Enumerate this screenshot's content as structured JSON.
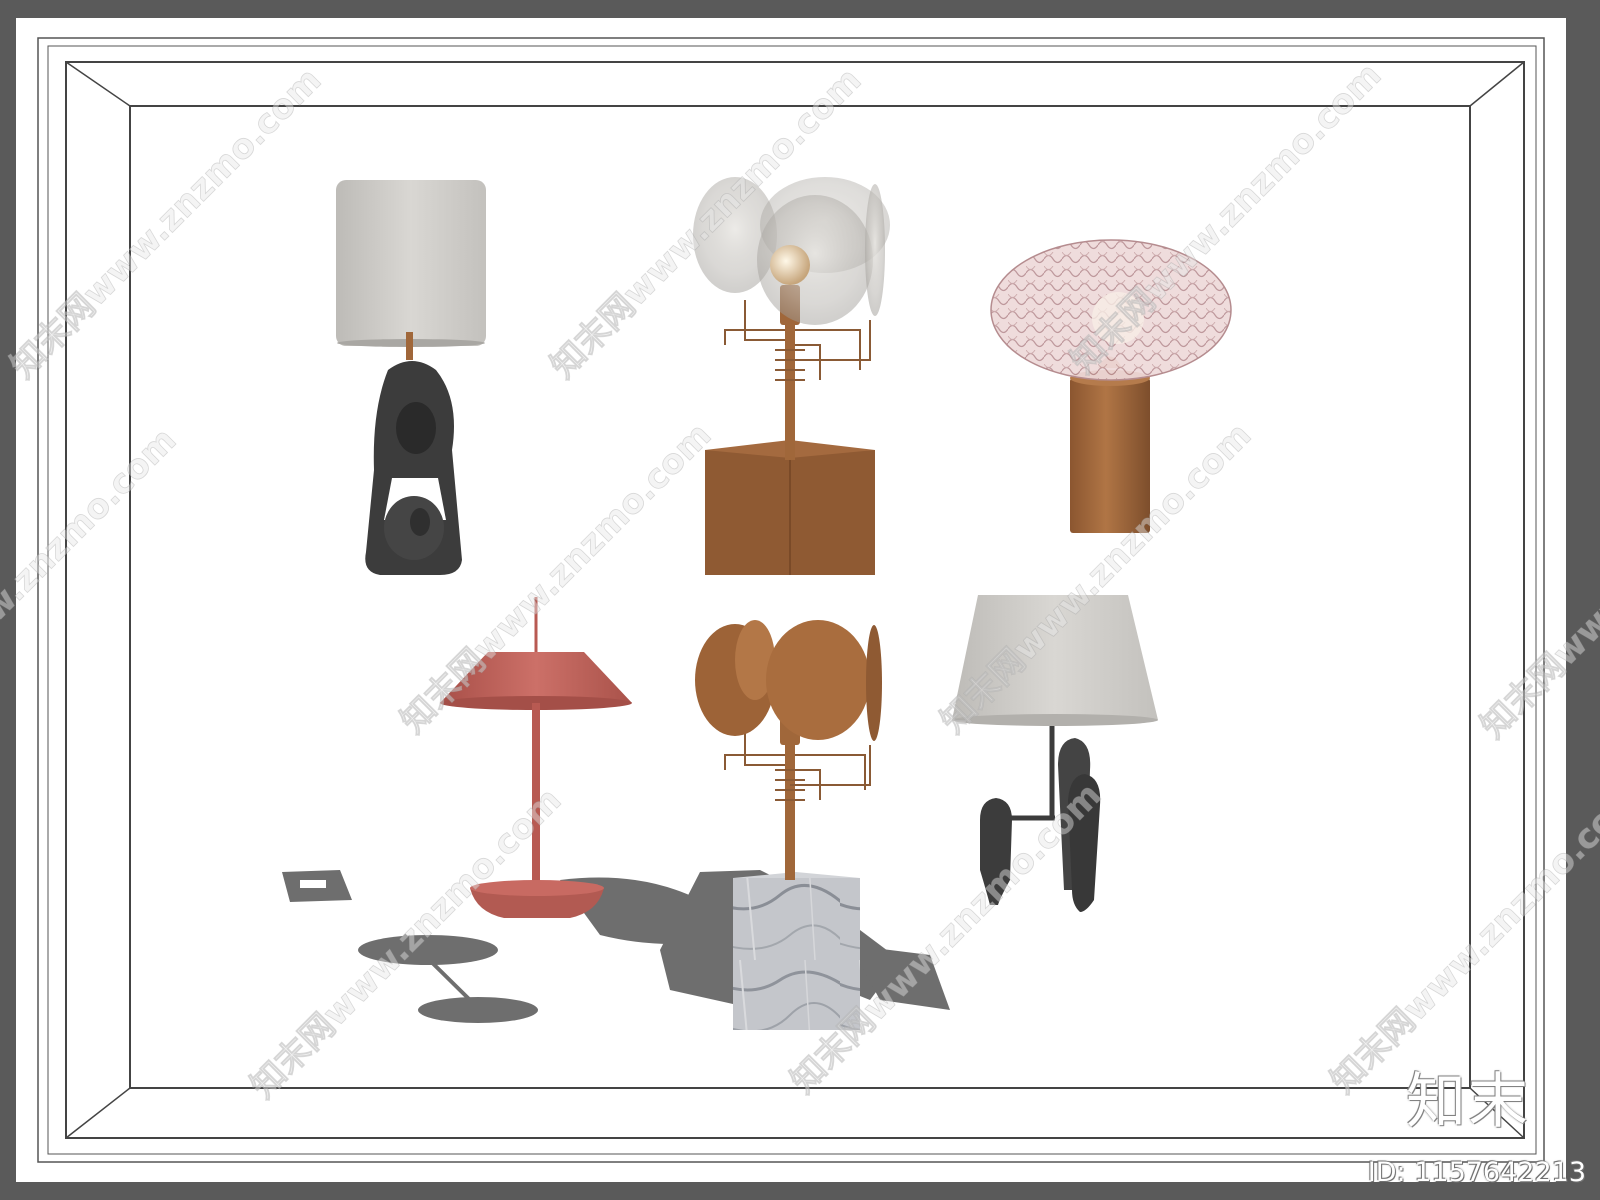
{
  "watermark": {
    "site_text": "知末网www.znzmo.com",
    "logo_text": "知末",
    "id_text": "ID: 1157642213"
  },
  "colors": {
    "outer_border": "#5a5a5a",
    "frame": "#ffffff",
    "frame_line": "#555555",
    "copper": "#a0673a",
    "copper_dark": "#7a4c2a",
    "charcoal": "#3c3c3c",
    "linen": "#cfcdc9",
    "terracotta": "#c2665d",
    "marble": "#b9bcc2",
    "shadow": "#6f6f6f"
  },
  "lamps": [
    {
      "name": "charcoal-sculpture-lamp",
      "icon": "table-lamp-icon"
    },
    {
      "name": "glass-disc-lamp",
      "icon": "table-lamp-icon"
    },
    {
      "name": "woven-mushroom-lamp",
      "icon": "table-lamp-icon"
    },
    {
      "name": "terracotta-mushroom-lamp",
      "icon": "table-lamp-icon"
    },
    {
      "name": "copper-disc-marble-lamp",
      "icon": "table-lamp-icon"
    },
    {
      "name": "charcoal-arm-lamp",
      "icon": "table-lamp-icon"
    }
  ]
}
